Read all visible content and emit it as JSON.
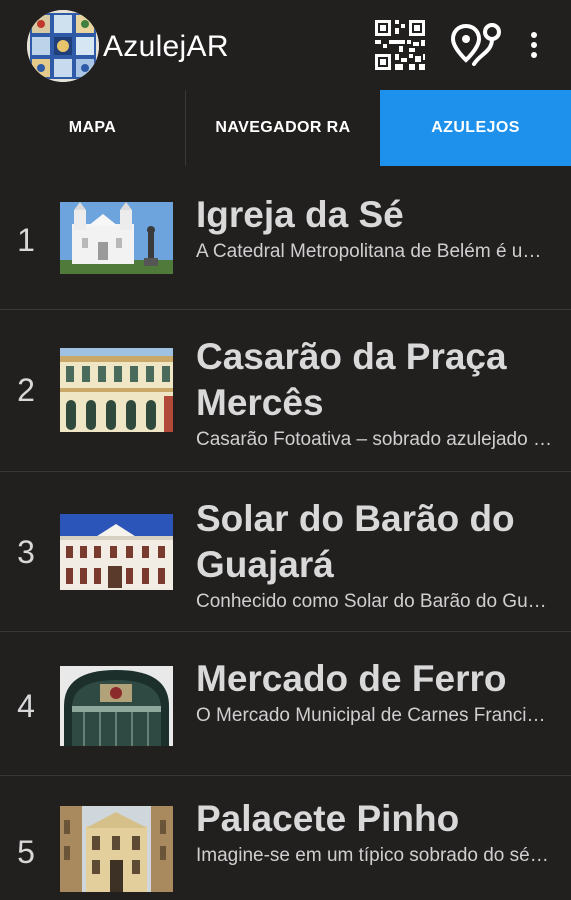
{
  "app": {
    "title": "AzulejAR",
    "logo_icon": "azulejo-tile-logo",
    "qr_icon": "qr-code-icon",
    "route_icon": "route-pin-icon",
    "more_icon": "more-vert-icon"
  },
  "tabs": [
    {
      "label": "MAPA",
      "selected": false
    },
    {
      "label": "NAVEGADOR RA",
      "selected": false
    },
    {
      "label": "AZULEJOS",
      "selected": true
    }
  ],
  "colors": {
    "background": "#221f1f",
    "accent": "#1e91ec",
    "divider": "#3a3636"
  },
  "items": [
    {
      "number": "1",
      "title_line1": "Igreja da Sé",
      "title_line2": "",
      "description": "A Catedral Metropolitana de Belém é um dos principais templos"
    },
    {
      "number": "2",
      "title_line1": "Casarão da Praça",
      "title_line2": "Mercês",
      "description": "Casarão Fotoativa – sobrado azulejado da Praça das Mercês"
    },
    {
      "number": "3",
      "title_line1": "Solar do Barão do",
      "title_line2": "Guajará",
      "description": "Conhecido como Solar do Barão do Guajará, o prédio abriga"
    },
    {
      "number": "4",
      "title_line1": "Mercado de Ferro",
      "title_line2": "",
      "description": "O Mercado Municipal de Carnes Francisco Bolonha"
    },
    {
      "number": "5",
      "title_line1": "Palacete Pinho",
      "title_line2": "",
      "description": "Imagine-se em um típico sobrado do século XIX"
    }
  ]
}
